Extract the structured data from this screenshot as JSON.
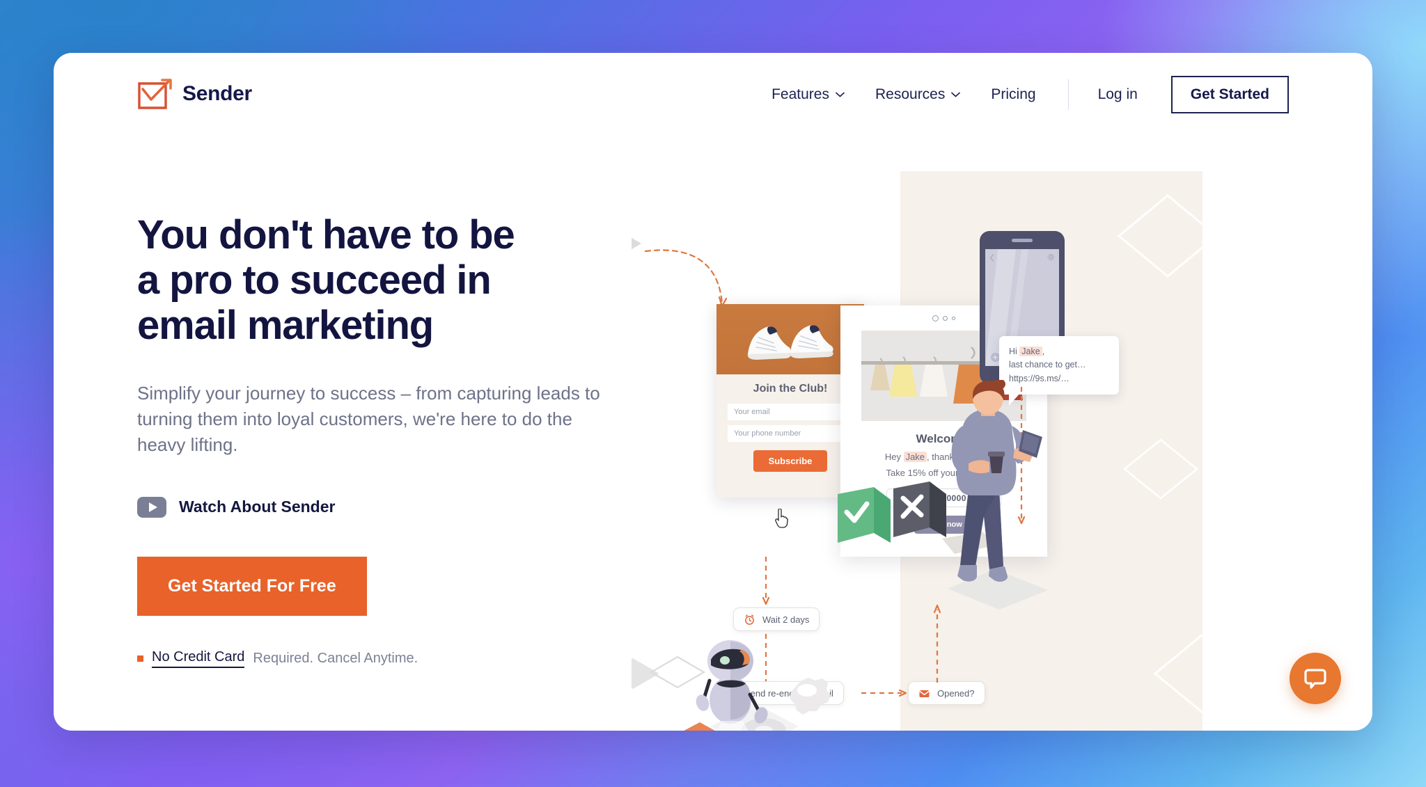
{
  "brand": {
    "name": "Sender",
    "logo_icon": "envelope-check-arrow-icon"
  },
  "nav": {
    "items": [
      {
        "label": "Features",
        "has_dropdown": true,
        "icon": "chevron-down-icon"
      },
      {
        "label": "Resources",
        "has_dropdown": true,
        "icon": "chevron-down-icon"
      },
      {
        "label": "Pricing",
        "has_dropdown": false
      }
    ],
    "login_label": "Log in",
    "get_started_label": "Get Started"
  },
  "hero": {
    "headline_line1": "You don't have to be",
    "headline_line2": "a pro to succeed in",
    "headline_line3": "email marketing",
    "subheading": "Simplify your journey to success – from capturing leads to turning them into loyal customers, we're here to do the heavy lifting.",
    "watch_label": "Watch About Sender",
    "watch_icon": "play-button-icon",
    "cta_label": "Get Started For Free",
    "note_strong": "No Credit Card",
    "note_rest": " Required. Cancel Anytime.",
    "note_bullet_icon": "square-bullet-icon"
  },
  "illustration": {
    "popup": {
      "close_icon": "close-x-icon",
      "title": "Join the Club!",
      "email_placeholder": "Your email",
      "phone_placeholder": "Your phone number",
      "subscribe_label": "Subscribe",
      "image_alt": "white-sneakers-photo"
    },
    "cursor_icon": "pointing-hand-cursor",
    "email_card": {
      "title": "Welcome!",
      "greeting_prefix": "Hey ",
      "greeting_name": "Jake",
      "greeting_suffix": ", thanks for joining!",
      "offer_line": "Take 15% off your first order:",
      "code": "CODE0000",
      "shop_label": "Shop now",
      "image_alt": "clothing-rack-photo"
    },
    "sms": {
      "line1_prefix": "Hi ",
      "line1_name": "Jake",
      "line1_suffix": ",",
      "line2": "last chance to get…",
      "line3": "https://9s.ms/…"
    },
    "phone": {
      "back_icon": "chevron-left-icon",
      "settings_icon": "gear-icon",
      "attach_icon": "plus-icon",
      "send_icon": "send-paper-plane-icon"
    },
    "flow_nodes": [
      {
        "label": "Wait 2 days",
        "icon": "alarm-clock-icon"
      },
      {
        "label": "Send re-engage email",
        "icon": "envelope-icon"
      },
      {
        "label": "Opened?",
        "icon": "envelope-icon"
      }
    ],
    "decision_blocks": [
      {
        "name": "yes-block",
        "icon": "check-icon",
        "color": "#5cb57f"
      },
      {
        "name": "no-block",
        "icon": "x-icon",
        "color": "#4b4d57"
      }
    ],
    "robot_alt": "robot-mascot-with-gears",
    "person_alt": "person-holding-phone-and-coffee"
  },
  "chat": {
    "icon": "chat-bubble-icon",
    "accent": "#e8772f"
  },
  "colors": {
    "accent_orange": "#e8622a",
    "headline_navy": "#131540",
    "body_gray": "#6e7288",
    "beige_panel": "#f6f1eb"
  }
}
